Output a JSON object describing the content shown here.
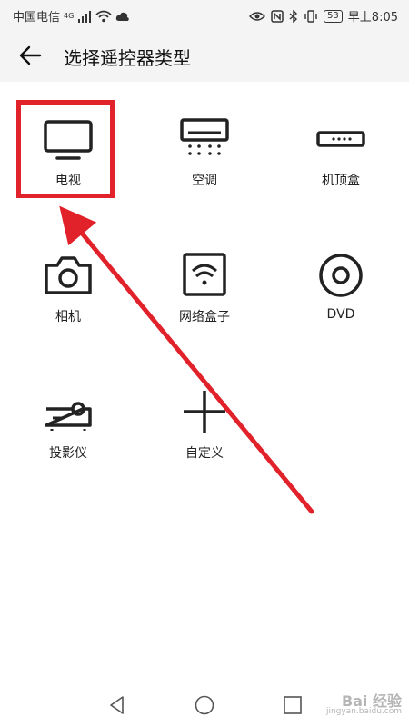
{
  "status_bar": {
    "carrier": "中国电信",
    "network": "4G",
    "battery": "53",
    "time": "早上8:05"
  },
  "header": {
    "title": "选择遥控器类型",
    "back_icon": "arrow-left-icon"
  },
  "devices": [
    {
      "label": "电视",
      "icon": "tv-icon"
    },
    {
      "label": "空调",
      "icon": "air-conditioner-icon"
    },
    {
      "label": "机顶盒",
      "icon": "set-top-box-icon"
    },
    {
      "label": "相机",
      "icon": "camera-icon"
    },
    {
      "label": "网络盒子",
      "icon": "network-box-icon"
    },
    {
      "label": "DVD",
      "icon": "disc-icon"
    },
    {
      "label": "投影仪",
      "icon": "projector-icon"
    },
    {
      "label": "自定义",
      "icon": "plus-icon"
    }
  ],
  "annotation": {
    "highlight_color": "#e2222a"
  },
  "watermark": {
    "brand": "Bai 经验",
    "url": "jingyan.baidu.com"
  }
}
